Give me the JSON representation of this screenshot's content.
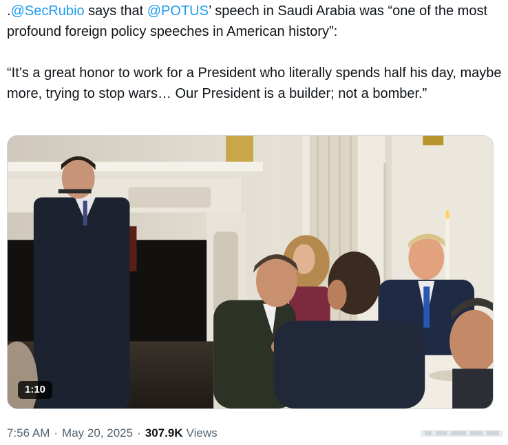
{
  "tweet": {
    "lead": ".",
    "mention1": "@SecRubio",
    "mid1": " says that ",
    "mention2": "@POTUS",
    "rest1": "’ speech in Saudi Arabia was “one of the most profound foreign policy speeches in American history”:",
    "quote": "“It’s a great honor to work for a President who literally spends half his day, maybe more, trying to stop wars… Our President is a builder; not a bomber.”"
  },
  "video": {
    "duration": "1:10"
  },
  "meta": {
    "time": "7:56 AM",
    "date": "May 20, 2025",
    "views_count": "307.9K",
    "views_label": "Views",
    "separator": "·"
  },
  "colors": {
    "link": "#1d9bf0",
    "text": "#0f1419",
    "secondary": "#536471"
  }
}
